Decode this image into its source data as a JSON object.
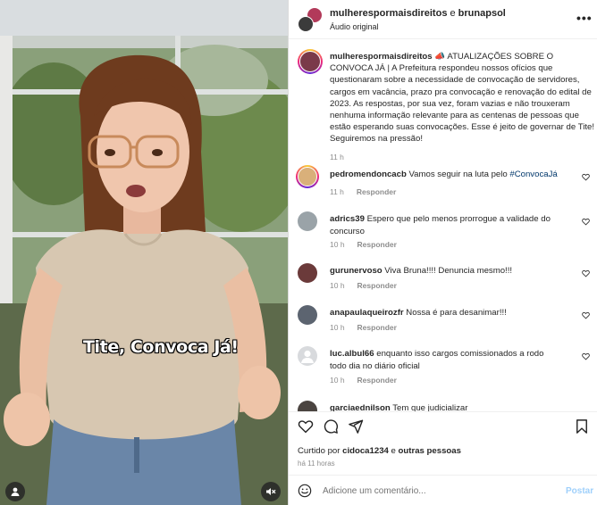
{
  "video": {
    "overlay_text": "Tite, Convoca Já!"
  },
  "header": {
    "account_primary": "mulherespormaisdireitos",
    "conjunction": " e ",
    "account_secondary": "brunapsol",
    "audio": "Áudio original",
    "more_icon": "more-horizontal-icon"
  },
  "caption": {
    "username": "mulherespormaisdireitos",
    "text": " 📣 ATUALIZAÇÕES SOBRE O CONVOCA JÁ | A Prefeitura respondeu nossos ofícios que questionaram sobre a necessidade de convocação de servidores, cargos em vacância, prazo pra convocação e renovação do edital de 2023. As respostas, por sua vez, foram vazias e não trouxeram nenhuma informação relevante para as centenas de pessoas que estão esperando suas convocações. Esse é jeito de governar de Tite! Seguiremos na pressão!",
    "time": "11 h"
  },
  "comments": [
    {
      "username": "pedromendoncacb",
      "text": " Vamos seguir na luta pelo ",
      "hashtag": "#ConvocaJá",
      "time": "11 h",
      "reply": "Responder"
    },
    {
      "username": "adrics39",
      "text": " Espero que pelo menos prorrogue a validade do concurso",
      "time": "10 h",
      "reply": "Responder"
    },
    {
      "username": "gurunervoso",
      "text": " Viva Bruna!!!! Denuncia mesmo!!!",
      "time": "10 h",
      "reply": "Responder"
    },
    {
      "username": "anapaulaqueirozfr",
      "text": " Nossa é para desanimar!!!",
      "time": "10 h",
      "reply": "Responder"
    },
    {
      "username": "luc.albul66",
      "text": " enquanto isso cargos comissionados a rodo todo dia no diário oficial",
      "time": "10 h",
      "reply": "Responder"
    },
    {
      "username": "garciaednilson",
      "text": " Tem que judicializar",
      "time": "",
      "reply": ""
    }
  ],
  "likes": {
    "prefix": "Curtido por ",
    "user": "cidoca1234",
    "middle": " e ",
    "others": "outras pessoas"
  },
  "timestamp": "há 11 horas",
  "composer": {
    "placeholder": "Adicione um comentário...",
    "post_label": "Postar"
  },
  "colors": {
    "post_disabled": "#9fd0fb",
    "hashtag": "#00376b",
    "muted_text": "#8e8e8e"
  }
}
